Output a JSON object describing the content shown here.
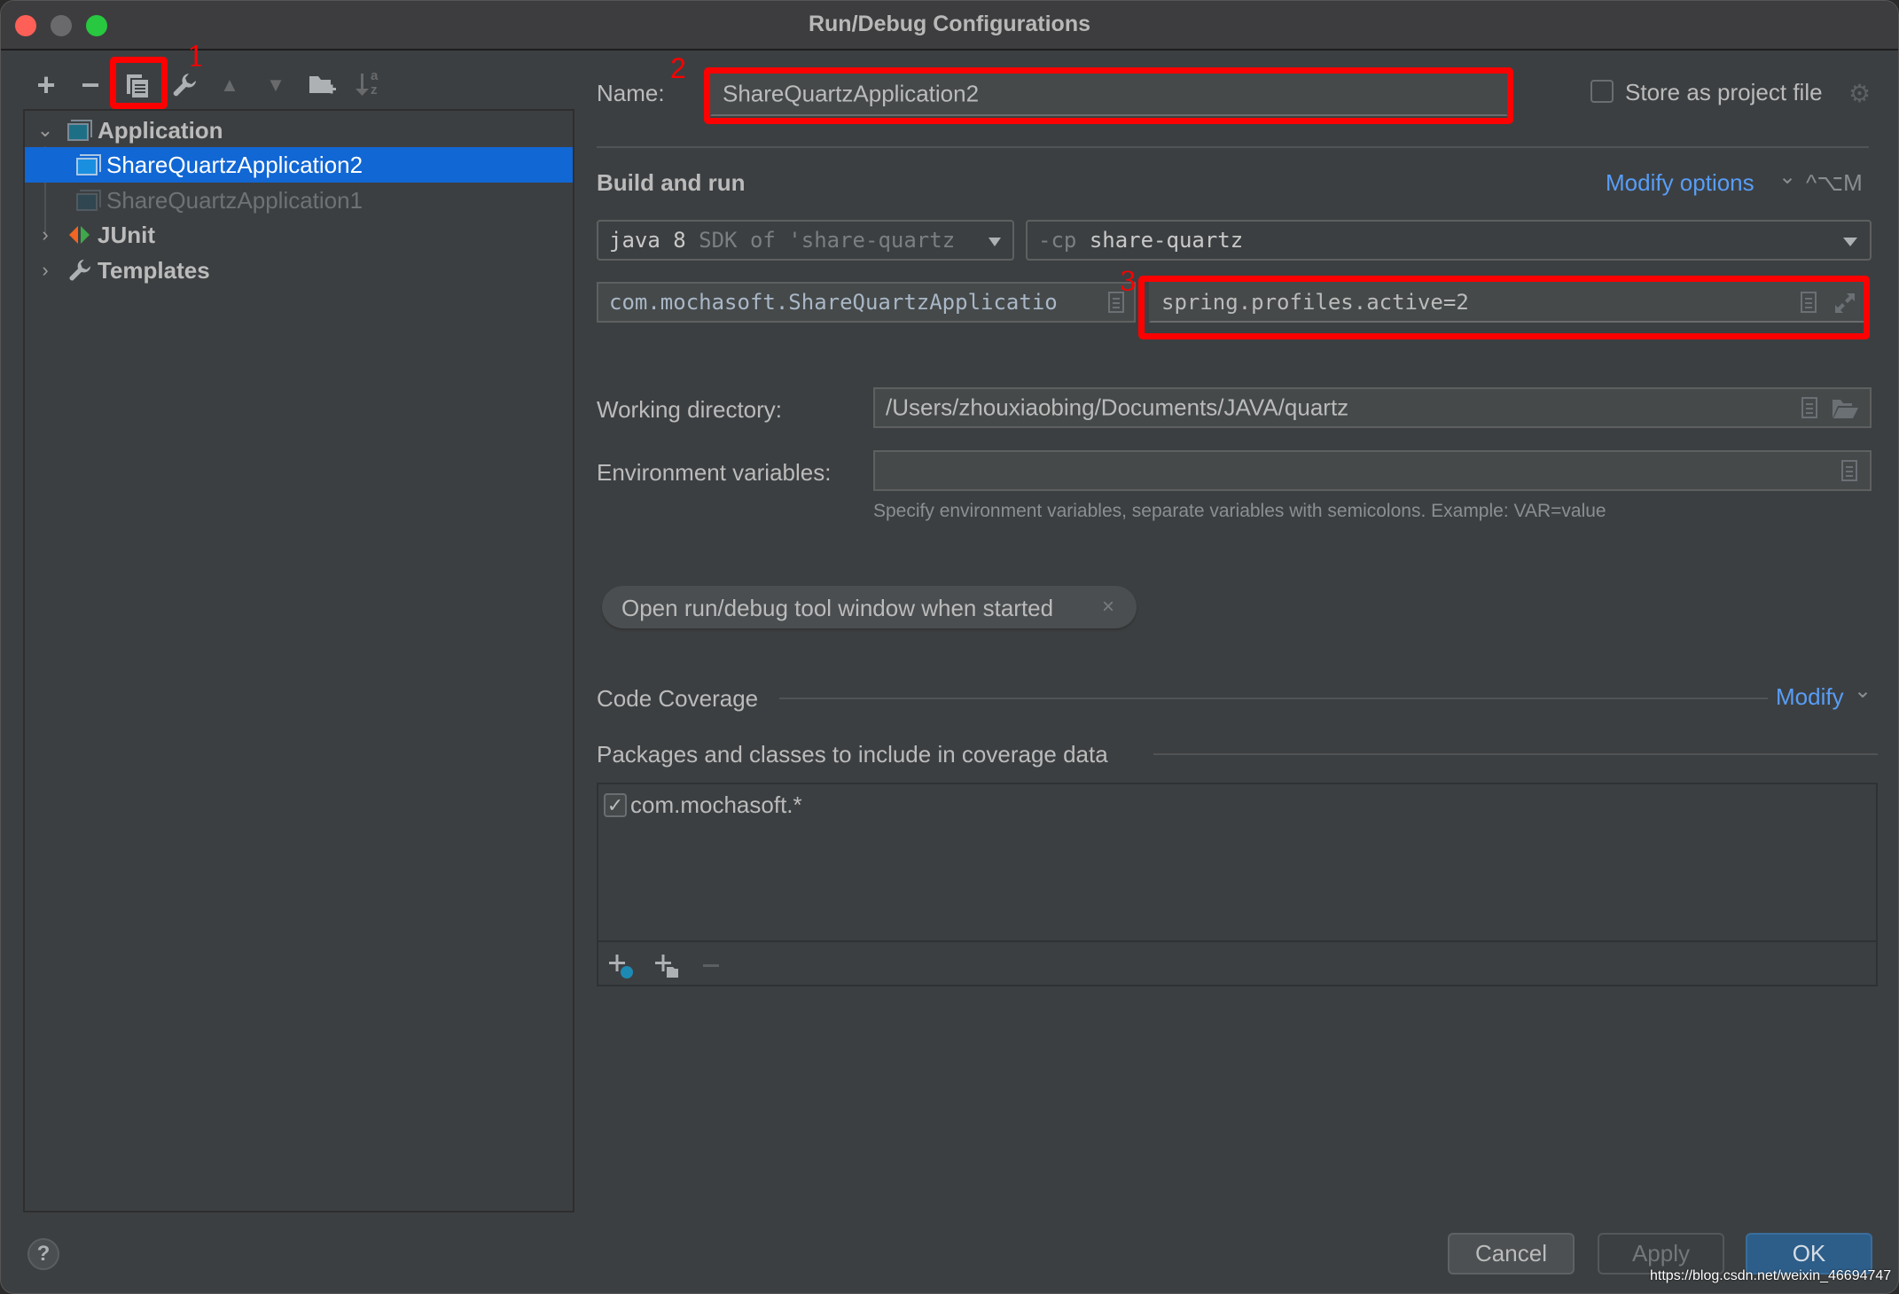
{
  "window": {
    "title": "Run/Debug Configurations"
  },
  "toolbar": {
    "add": "+",
    "remove": "−",
    "copy_marker": "1",
    "move_up": "▲",
    "move_down": "▼",
    "sort_a": "a",
    "sort_z": "z"
  },
  "tree": {
    "items": [
      {
        "label": "Application",
        "type": "group",
        "expanded": true
      },
      {
        "label": "ShareQuartzApplication2",
        "type": "config",
        "selected": true
      },
      {
        "label": "ShareQuartzApplication1",
        "type": "config",
        "selected": false
      },
      {
        "label": "JUnit",
        "type": "group",
        "expanded": false
      },
      {
        "label": "Templates",
        "type": "group",
        "expanded": false
      }
    ]
  },
  "form": {
    "name_label": "Name:",
    "name_value": "ShareQuartzApplication2",
    "name_marker": "2",
    "store_label": "Store as project file",
    "store_checked": false,
    "section_build": "Build and run",
    "modify_options": "Modify options",
    "modify_shortcut": "^⌥M",
    "jre_main": "java 8",
    "jre_muted": "SDK of 'share-quartz",
    "cp_prefix": "-cp",
    "cp_value": "share-quartz",
    "main_class": "com.mochasoft.ShareQuartzApplicatio",
    "args_marker": "3",
    "program_args": "spring.profiles.active=2",
    "workdir_label": "Working directory:",
    "workdir_value": "/Users/zhouxiaobing/Documents/JAVA/quartz",
    "env_label": "Environment variables:",
    "env_value": "",
    "env_hint": "Specify environment variables, separate variables with semicolons. Example: VAR=value",
    "chip_label": "Open run/debug tool window when started",
    "chip_close": "×",
    "coverage_label": "Code Coverage",
    "coverage_modify": "Modify",
    "packages_label": "Packages and classes to include in coverage data",
    "packages": [
      {
        "label": "com.mochasoft.*",
        "checked": true
      }
    ]
  },
  "footer": {
    "help": "?",
    "cancel": "Cancel",
    "apply": "Apply",
    "ok": "OK",
    "watermark": "https://blog.csdn.net/weixin_46694747"
  },
  "colors": {
    "selection": "#1167d4",
    "link": "#589df6",
    "annotation": "#ff0000",
    "ok_button": "#2d5e8a"
  }
}
